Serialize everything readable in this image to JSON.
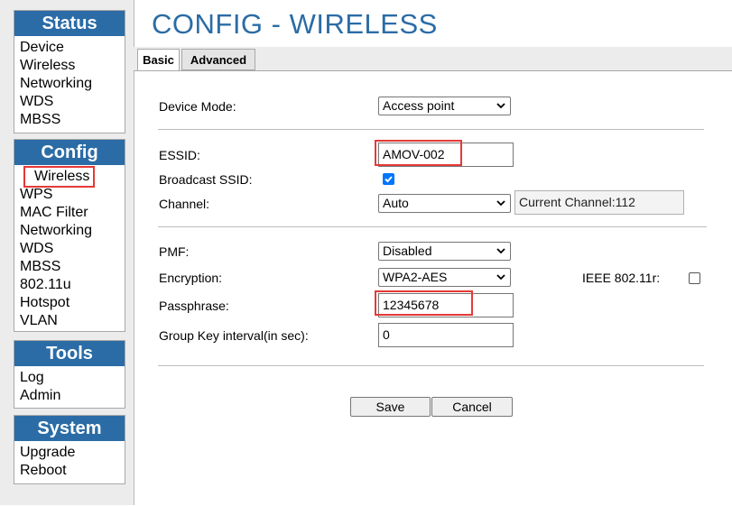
{
  "page_title": "CONFIG - WIRELESS",
  "sidebar": {
    "status": {
      "header": "Status",
      "items": [
        "Device",
        "Wireless",
        "Networking",
        "WDS",
        "MBSS"
      ]
    },
    "config": {
      "header": "Config",
      "items": [
        "Wireless",
        "WPS",
        "MAC Filter",
        "Networking",
        "WDS",
        "MBSS",
        "802.11u",
        "Hotspot",
        "VLAN"
      ],
      "selected": "Wireless"
    },
    "tools": {
      "header": "Tools",
      "items": [
        "Log",
        "Admin"
      ]
    },
    "system": {
      "header": "System",
      "items": [
        "Upgrade",
        "Reboot"
      ]
    }
  },
  "tabs": {
    "basic": "Basic",
    "advanced": "Advanced",
    "active": "Basic"
  },
  "form": {
    "device_mode": {
      "label": "Device Mode:",
      "value": "Access point"
    },
    "essid": {
      "label": "ESSID:",
      "value": "AMOV-002"
    },
    "broadcast_ssid": {
      "label": "Broadcast SSID:",
      "checked": true
    },
    "channel": {
      "label": "Channel:",
      "value": "Auto",
      "current": "Current Channel:112"
    },
    "pmf": {
      "label": "PMF:",
      "value": "Disabled"
    },
    "encryption": {
      "label": "Encryption:",
      "value": "WPA2-AES"
    },
    "ieee_80211r": {
      "label": "IEEE 802.11r:",
      "checked": false
    },
    "passphrase": {
      "label": "Passphrase:",
      "value": "12345678"
    },
    "group_key_interval": {
      "label": "Group Key interval(in sec):",
      "value": "0"
    }
  },
  "buttons": {
    "save": "Save",
    "cancel": "Cancel"
  },
  "colors": {
    "brand_blue": "#2b6ca6",
    "highlight_red": "#e53935",
    "checkbox_blue": "#0075ff"
  }
}
